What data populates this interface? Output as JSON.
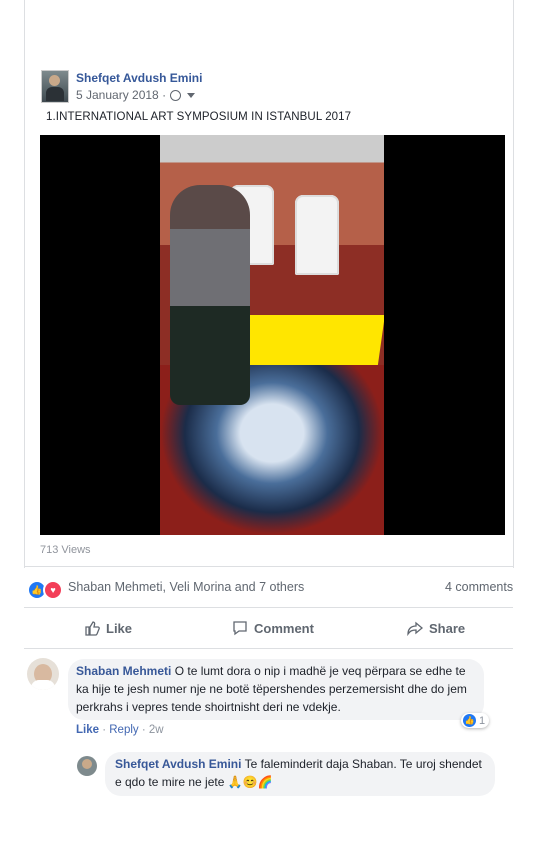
{
  "post": {
    "author": "Shefqet Avdush Emini",
    "date": "5 January 2018 ·",
    "text": "1.INTERNATIONAL ART SYMPOSIUM IN ISTANBUL 2017",
    "views": "713 Views"
  },
  "reactions": {
    "names": "Shaban Mehmeti, Veli Morina and 7 others",
    "comments": "4 comments"
  },
  "actions": {
    "like": "Like",
    "comment": "Comment",
    "share": "Share"
  },
  "comments": [
    {
      "author": "Shaban Mehmeti",
      "text": "O te lumt dora o nip i madhë je veq përpara se edhe te ka hije te jesh numer nje ne botë tëpershendes perzemersisht dhe do jem perkrahs i vepres tende shoirtnisht deri ne vdekje.",
      "like": "Like",
      "reply": "Reply",
      "age": "2w",
      "like_count": "1"
    },
    {
      "author": "Shefqet Avdush Emini",
      "text": "Te faleminderit daja Shaban. Te uroj shendet e qdo te mire ne jete 🙏😊🌈"
    }
  ],
  "colors": {
    "link": "#385898",
    "like": "#2078f4",
    "love": "#f33e58"
  }
}
